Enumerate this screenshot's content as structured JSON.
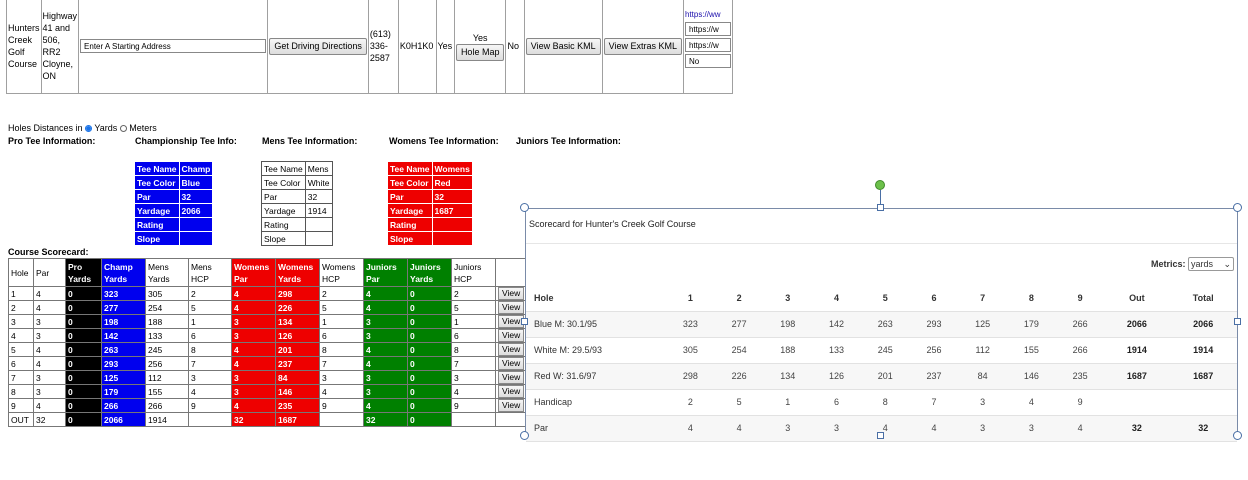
{
  "listing": {
    "name": "Hunters Creek Golf Course",
    "address": "Highway 41 and 506, RR2 Cloyne, ON",
    "start_address_placeholder": "Enter A Starting Address",
    "driving_button": "Get Driving Directions",
    "phone": "(613) 336-2587",
    "postal": "K0H1K0",
    "yes1": "Yes",
    "yes2": "Yes",
    "hole_map_button": "Hole Map",
    "no1": "No",
    "basic_kml_button": "View Basic KML",
    "extras_kml_button": "View Extras KML",
    "url_link": "https://ww",
    "url_input1": "https://w",
    "url_input2": "https://w",
    "no_input": "No"
  },
  "distances": {
    "label": "Holes Distances in",
    "yards": "Yards",
    "meters": "Meters",
    "selected": "yards"
  },
  "tee_headings": {
    "pro": "Pro Tee Information:",
    "champ": "Championship Tee Info:",
    "mens": "Mens Tee Information:",
    "womens": "Womens Tee Information:",
    "juniors": "Juniors Tee Information:"
  },
  "tee_tables": {
    "champ": [
      [
        "Tee Name",
        "Champ"
      ],
      [
        "Tee Color",
        "Blue"
      ],
      [
        "Par",
        "32"
      ],
      [
        "Yardage",
        "2066"
      ],
      [
        "Rating",
        ""
      ],
      [
        "Slope",
        ""
      ]
    ],
    "mens": [
      [
        "Tee Name",
        "Mens"
      ],
      [
        "Tee Color",
        "White"
      ],
      [
        "Par",
        "32"
      ],
      [
        "Yardage",
        "1914"
      ],
      [
        "Rating",
        ""
      ],
      [
        "Slope",
        ""
      ]
    ],
    "womens": [
      [
        "Tee Name",
        "Womens"
      ],
      [
        "Tee Color",
        "Red"
      ],
      [
        "Par",
        "32"
      ],
      [
        "Yardage",
        "1687"
      ],
      [
        "Rating",
        ""
      ],
      [
        "Slope",
        ""
      ]
    ]
  },
  "scorecard": {
    "title": "Course Scorecard:",
    "headers": [
      "Hole",
      "Par",
      "Pro Yards",
      "Champ Yards",
      "Mens Yards",
      "Mens HCP",
      "Womens Par",
      "Womens Yards",
      "Womens HCP",
      "Juniors Par",
      "Juniors Yards",
      "Juniors HCP"
    ],
    "rows": [
      [
        "1",
        "4",
        "0",
        "323",
        "305",
        "2",
        "4",
        "298",
        "2",
        "4",
        "0",
        "2"
      ],
      [
        "2",
        "4",
        "0",
        "277",
        "254",
        "5",
        "4",
        "226",
        "5",
        "4",
        "0",
        "5"
      ],
      [
        "3",
        "3",
        "0",
        "198",
        "188",
        "1",
        "3",
        "134",
        "1",
        "3",
        "0",
        "1"
      ],
      [
        "4",
        "3",
        "0",
        "142",
        "133",
        "6",
        "3",
        "126",
        "6",
        "3",
        "0",
        "6"
      ],
      [
        "5",
        "4",
        "0",
        "263",
        "245",
        "8",
        "4",
        "201",
        "8",
        "4",
        "0",
        "8"
      ],
      [
        "6",
        "4",
        "0",
        "293",
        "256",
        "7",
        "4",
        "237",
        "7",
        "4",
        "0",
        "7"
      ],
      [
        "7",
        "3",
        "0",
        "125",
        "112",
        "3",
        "3",
        "84",
        "3",
        "3",
        "0",
        "3"
      ],
      [
        "8",
        "3",
        "0",
        "179",
        "155",
        "4",
        "3",
        "146",
        "4",
        "3",
        "0",
        "4"
      ],
      [
        "9",
        "4",
        "0",
        "266",
        "266",
        "9",
        "4",
        "235",
        "9",
        "4",
        "0",
        "9"
      ]
    ],
    "view_label": "View",
    "out": [
      "OUT",
      "32",
      "0",
      "2066",
      "1914",
      "",
      "32",
      "1687",
      "",
      "32",
      "0",
      ""
    ]
  },
  "popup": {
    "title": "Scorecard for Hunter's Creek Golf Course",
    "metrics_label": "Metrics:",
    "metrics_value": "yards",
    "columns": [
      "Hole",
      "1",
      "2",
      "3",
      "4",
      "5",
      "6",
      "7",
      "8",
      "9",
      "Out",
      "Total"
    ],
    "rows": [
      [
        "Blue M: 30.1/95",
        "323",
        "277",
        "198",
        "142",
        "263",
        "293",
        "125",
        "179",
        "266",
        "2066",
        "2066"
      ],
      [
        "White M: 29.5/93",
        "305",
        "254",
        "188",
        "133",
        "245",
        "256",
        "112",
        "155",
        "266",
        "1914",
        "1914"
      ],
      [
        "Red W: 31.6/97",
        "298",
        "226",
        "134",
        "126",
        "201",
        "237",
        "84",
        "146",
        "235",
        "1687",
        "1687"
      ],
      [
        "Handicap",
        "2",
        "5",
        "1",
        "6",
        "8",
        "7",
        "3",
        "4",
        "9",
        "",
        ""
      ],
      [
        "Par",
        "4",
        "4",
        "3",
        "3",
        "4",
        "4",
        "3",
        "3",
        "4",
        "32",
        "32"
      ]
    ]
  }
}
